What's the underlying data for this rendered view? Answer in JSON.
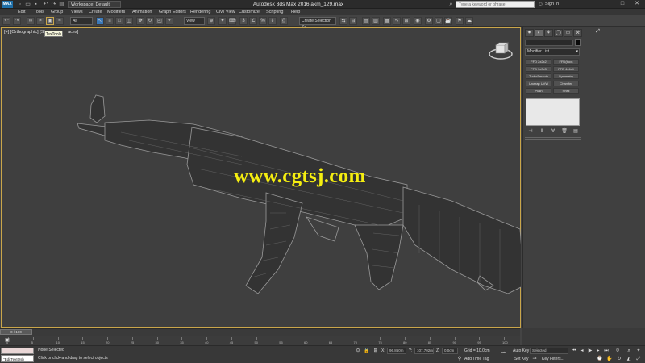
{
  "title_bar": {
    "app_icon": "MAX",
    "workspace": "Workspace: Default",
    "window_title": "Autodesk 3ds Max 2016     akm_129.max",
    "search_placeholder": "Type a keyword or phrase",
    "sign_in": "Sign In",
    "quick_access_icons": [
      "new-icon",
      "open-icon",
      "save-icon",
      "undo-icon",
      "redo-icon",
      "project-icon"
    ],
    "window_buttons": [
      "_",
      "□",
      "✕"
    ]
  },
  "menu": {
    "items": [
      "Edit",
      "Tools",
      "Group",
      "Views",
      "Create",
      "Modifiers",
      "Animation",
      "Graph Editors",
      "Rendering",
      "Civil View",
      "Customize",
      "Scripting",
      "Help"
    ]
  },
  "toolbar": {
    "selection_filter": "All",
    "reference_coord": "View",
    "named_selection": "Create Selection Se",
    "tooltip": "TexTools"
  },
  "viewport": {
    "label_parts": [
      "[+]",
      "[Orthographic]",
      "[Sha",
      "aces]"
    ],
    "watermark": "www.cgtsj.com"
  },
  "command_panel": {
    "modifier_list": "Modifier List",
    "modifier_buttons": [
      "FFD 2x2x2",
      "FFD(box)",
      "FFD 3x3x3",
      "FFD 4x4x4",
      "TurboSmooth",
      "Symmetry",
      "Unwrap UVW",
      "Chamfer",
      "Push",
      "Shell"
    ],
    "accent_color": "#caa64a"
  },
  "time_slider": {
    "position": "0 / 100",
    "current_frame": 0,
    "total_frames": 100,
    "ticks": [
      "0",
      "5",
      "10",
      "15",
      "20",
      "25",
      "30",
      "35",
      "40",
      "45",
      "50",
      "55",
      "60",
      "65",
      "70",
      "75",
      "80",
      "85",
      "90",
      "95",
      "100"
    ]
  },
  "status_bar": {
    "maxscript": "\"EditTextOsb",
    "selection": "None Selected",
    "prompt": "Click or click-and-drag to select objects",
    "x": "96.860m",
    "y": "107.702m",
    "z": "0.0cm",
    "grid": "Grid = 10.0cm",
    "add_time_tag": "Add Time Tag",
    "auto_key": "Auto Key",
    "set_key": "Set Key",
    "selected": "Selected",
    "key_filters": "Key Filters..."
  }
}
